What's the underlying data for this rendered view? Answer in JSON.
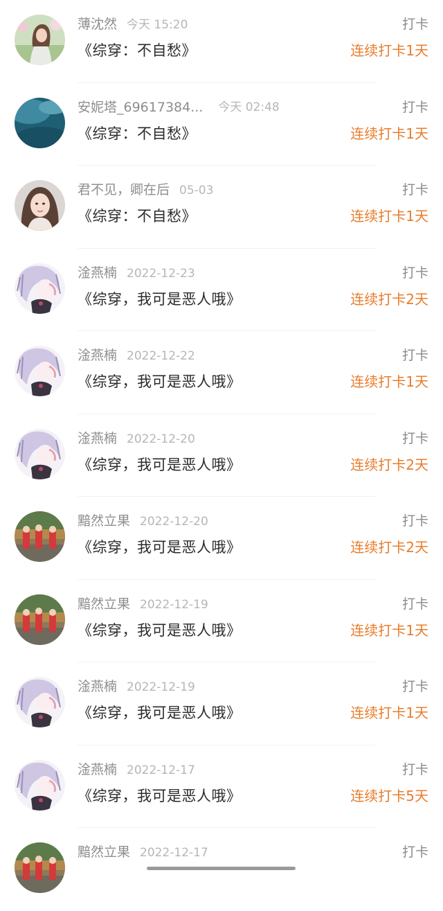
{
  "feed": {
    "items": [
      {
        "name": "薄沈然",
        "time": "今天 15:20",
        "title": "《综穿：不自愁》",
        "action": "打卡",
        "streak": "连续打卡1天",
        "avatar": "woman-field-avatar"
      },
      {
        "name": "安妮塔_69617384...",
        "time": "今天 02:48",
        "title": "《综穿：不自愁》",
        "action": "打卡",
        "streak": "连续打卡1天",
        "avatar": "blue-abstract-avatar"
      },
      {
        "name": "君不见，卿在后",
        "time": "05-03",
        "title": "《综穿：不自愁》",
        "action": "打卡",
        "streak": "连续打卡1天",
        "avatar": "woman-portrait-avatar"
      },
      {
        "name": "淦燕楠",
        "time": "2022-12-23",
        "title": "《综穿，我可是恶人哦》",
        "action": "打卡",
        "streak": "连续打卡2天",
        "avatar": "anime-girl-avatar"
      },
      {
        "name": "淦燕楠",
        "time": "2022-12-22",
        "title": "《综穿，我可是恶人哦》",
        "action": "打卡",
        "streak": "连续打卡1天",
        "avatar": "anime-girl-avatar"
      },
      {
        "name": "淦燕楠",
        "time": "2022-12-20",
        "title": "《综穿，我可是恶人哦》",
        "action": "打卡",
        "streak": "连续打卡2天",
        "avatar": "anime-girl-avatar"
      },
      {
        "name": "黯然立果",
        "time": "2022-12-20",
        "title": "《综穿，我可是恶人哦》",
        "action": "打卡",
        "streak": "连续打卡2天",
        "avatar": "group-photo-avatar"
      },
      {
        "name": "黯然立果",
        "time": "2022-12-19",
        "title": "《综穿，我可是恶人哦》",
        "action": "打卡",
        "streak": "连续打卡1天",
        "avatar": "group-photo-avatar"
      },
      {
        "name": "淦燕楠",
        "time": "2022-12-19",
        "title": "《综穿，我可是恶人哦》",
        "action": "打卡",
        "streak": "连续打卡1天",
        "avatar": "anime-girl-avatar"
      },
      {
        "name": "淦燕楠",
        "time": "2022-12-17",
        "title": "《综穿，我可是恶人哦》",
        "action": "打卡",
        "streak": "连续打卡5天",
        "avatar": "anime-girl-avatar"
      },
      {
        "name": "黯然立果",
        "time": "2022-12-17",
        "title": "",
        "action": "打卡",
        "streak": "",
        "avatar": "group-photo-avatar"
      }
    ]
  },
  "colors": {
    "streak": "#e87c2b",
    "name": "#8e8e8e",
    "time": "#b6b6b6",
    "title": "#2a2a2a"
  }
}
